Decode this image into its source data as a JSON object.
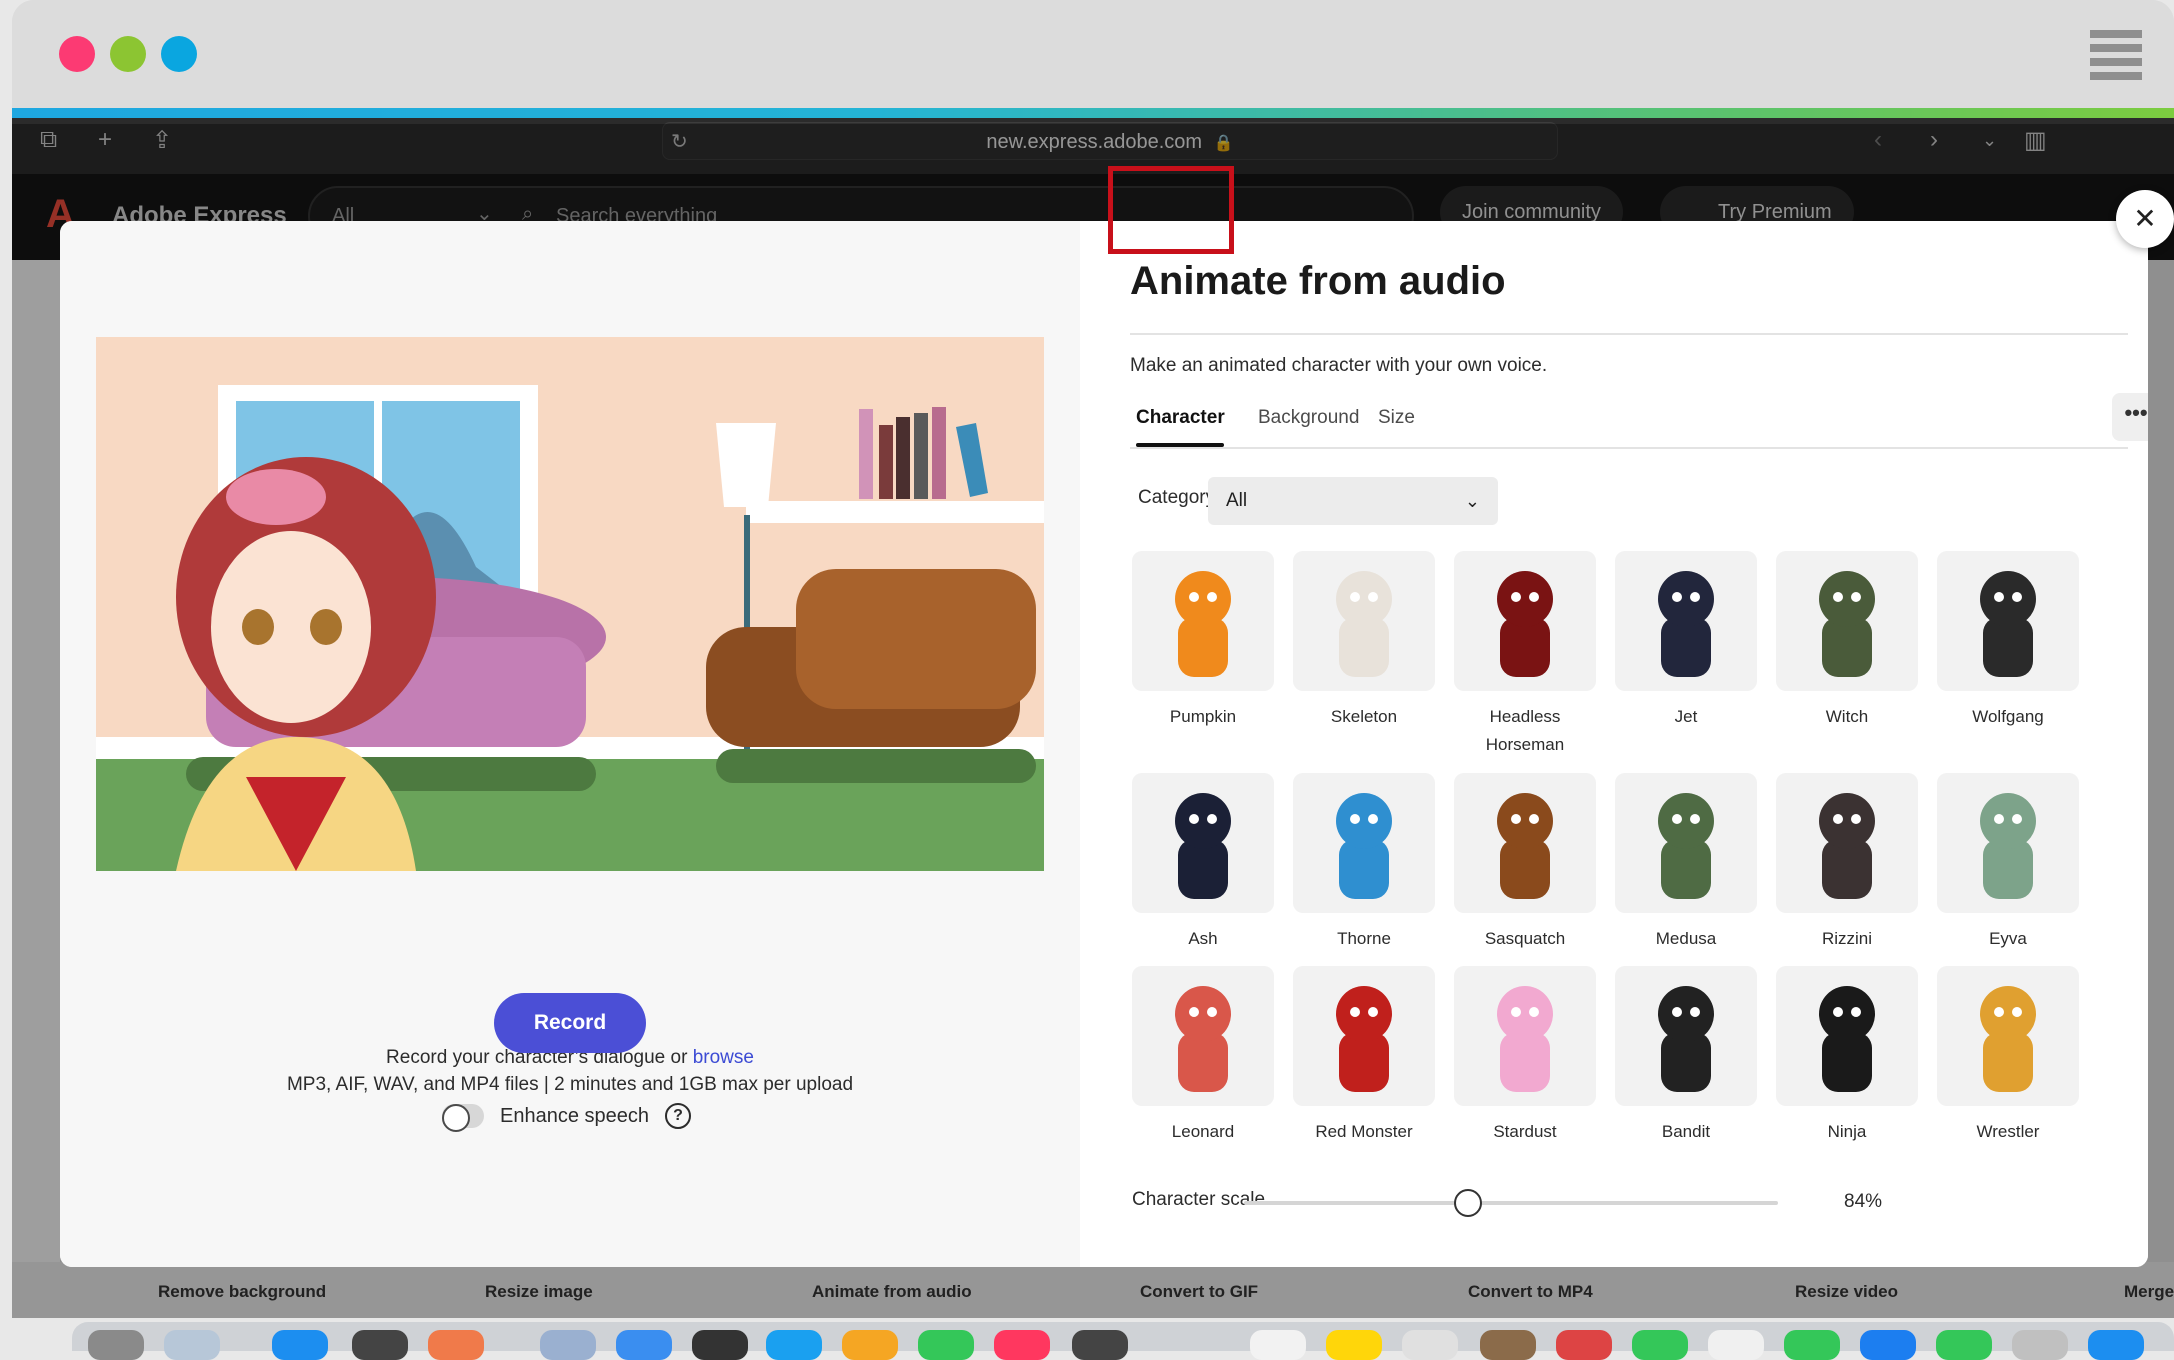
{
  "browser": {
    "url": "new.express.adobe.com"
  },
  "app": {
    "brand": "Adobe Express",
    "search_scope": "All",
    "search_placeholder": "Search everything",
    "join_label": "Join community",
    "premium_label": "Try Premium"
  },
  "bottom_links": [
    "Remove background",
    "Resize image",
    "Animate from audio",
    "Convert to GIF",
    "Convert to MP4",
    "Resize video",
    "Merge"
  ],
  "modal": {
    "title": "Animate from audio",
    "subtitle": "Make an animated character with your own voice.",
    "tabs": [
      "Character",
      "Background",
      "Size"
    ],
    "more": "•••",
    "category_label": "Category",
    "category_value": "All",
    "record_prompt": "Record your character’s dialogue or",
    "browse_label": "browse",
    "file_note": "MP3, AIF, WAV, and MP4 files | 2 minutes and 1GB max per upload",
    "record_label": "Record",
    "enhance_label": "Enhance speech",
    "help_glyph": "?",
    "scale_label": "Character scale",
    "scale_value": "84%",
    "scale_fraction": 0.42,
    "close_glyph": "✕"
  },
  "characters": [
    {
      "name": "Pumpkin",
      "color": "#f08a1c"
    },
    {
      "name": "Skeleton",
      "color": "#e8e2da"
    },
    {
      "name": "Headless Horseman",
      "color": "#7a1313"
    },
    {
      "name": "Jet",
      "color": "#22263c"
    },
    {
      "name": "Witch",
      "color": "#4a5b3a"
    },
    {
      "name": "Wolfgang",
      "color": "#2a2a2a"
    },
    {
      "name": "Ash",
      "color": "#1b2036"
    },
    {
      "name": "Thorne",
      "color": "#2f8fd0"
    },
    {
      "name": "Sasquatch",
      "color": "#8a4a1c"
    },
    {
      "name": "Medusa",
      "color": "#4f6b44"
    },
    {
      "name": "Rizzini",
      "color": "#3b3232"
    },
    {
      "name": "Eyva",
      "color": "#7da38a"
    },
    {
      "name": "Leonard",
      "color": "#d9574a"
    },
    {
      "name": "Red Monster",
      "color": "#c0201c"
    },
    {
      "name": "Stardust",
      "color": "#f2a9d0"
    },
    {
      "name": "Bandit",
      "color": "#222222"
    },
    {
      "name": "Ninja",
      "color": "#1a1a1a"
    },
    {
      "name": "Wrestler",
      "color": "#e0a030"
    }
  ]
}
